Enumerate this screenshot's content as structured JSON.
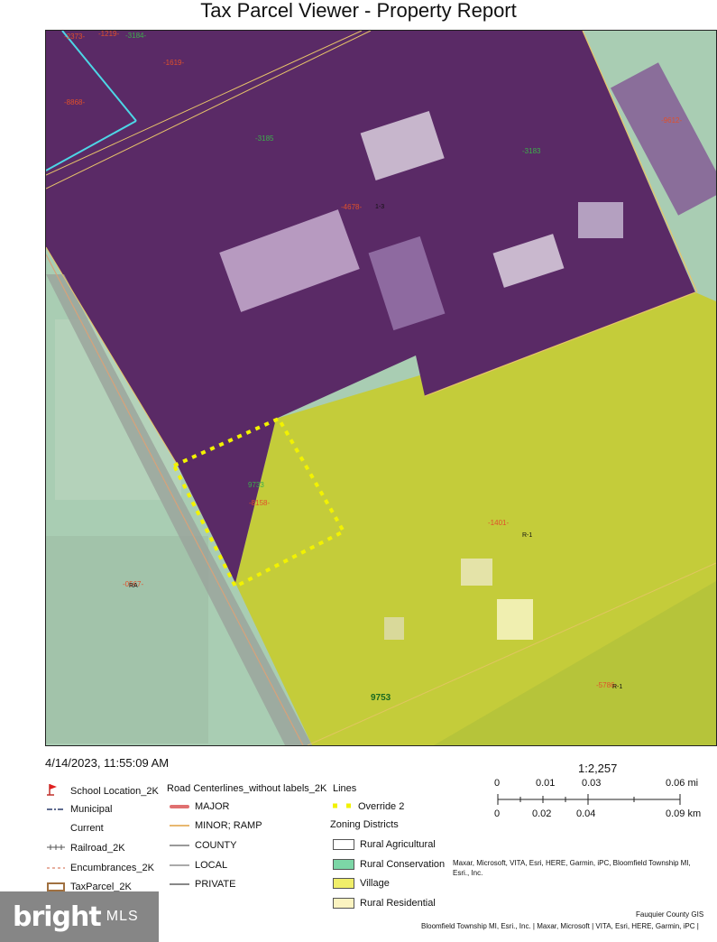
{
  "title": "Tax Parcel Viewer - Property Report",
  "timestamp": "4/14/2023, 11:55:09 AM",
  "map": {
    "parcel_ids": {
      "p1": "-2373-",
      "p2": "-1219-",
      "p3": "-3184-",
      "p4": "-1619-",
      "p5": "-8868-",
      "p6": "-3185",
      "p7": "-3183",
      "p8": "-4678-",
      "p9": "-9612-",
      "p10": "9733",
      "p11": "-8158-",
      "p12": "-1401-",
      "p13": "-0567-",
      "p14": "9753",
      "p15": "-5786-"
    },
    "zones": {
      "z1": "R-1",
      "z2": "RA",
      "z3": "R-1",
      "z4": "1-3"
    },
    "colors": {
      "village": "#c9d33a",
      "rural_conservation": "#9cc7a8",
      "industrial_overlay": "#5a2a66",
      "override": "#f2f200",
      "parcel_line": "#e8c46a",
      "railroad_blue": "#4dd6e6"
    }
  },
  "legend": {
    "col1": {
      "school": "School Location_2K",
      "municipal": "Municipal",
      "current": "Current",
      "railroad": "Railroad_2K",
      "encumbrances": "Encumbrances_2K",
      "taxparcel": "TaxParcel_2K"
    },
    "col2": {
      "heading": "Road Centerlines_without labels_2K",
      "major": "MAJOR",
      "minor": "MINOR; RAMP",
      "county": "COUNTY",
      "local": "LOCAL",
      "private": "PRIVATE"
    },
    "col3": {
      "lines": "Lines",
      "override": "Override 2",
      "zoning": "Zoning Districts",
      "rural_ag": "Rural Agricultural",
      "rural_cons": "Rural Conservation",
      "village": "Village",
      "rural_res": "Rural Residential"
    }
  },
  "scale": {
    "ratio": "1:2,257",
    "mi_labels": [
      "0",
      "0.01",
      "0.03",
      "0.06 mi"
    ],
    "km_labels": [
      "0",
      "0.02",
      "0.04",
      "0.09 km"
    ]
  },
  "attribution": {
    "line1": "Maxar, Microsoft, VITA, Esri, HERE, Garmin, iPC, Bloomfield Township MI,",
    "line2": "Esri., Inc.",
    "org": "Fauquier County GIS",
    "line3": "Bloomfield Township MI, Esri., Inc. | Maxar, Microsoft | VITA, Esri, HERE, Garmin, iPC |"
  },
  "watermark": {
    "brand": "bright",
    "suffix": "MLS"
  }
}
